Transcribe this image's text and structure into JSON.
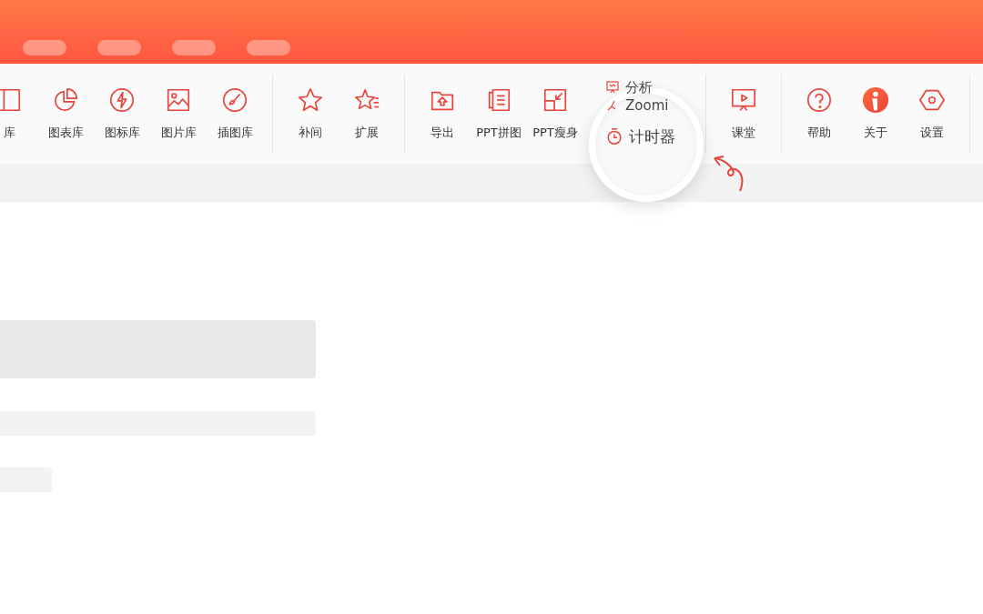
{
  "header": {
    "tabs": [
      {
        "kind": "placeholder"
      },
      {
        "kind": "placeholder"
      },
      {
        "kind": "placeholder"
      },
      {
        "kind": "placeholder"
      }
    ]
  },
  "toolbar": {
    "groups": [
      {
        "items": [
          {
            "label": "库"
          },
          {
            "label": "图表库"
          },
          {
            "label": "图标库"
          },
          {
            "label": "图片库"
          },
          {
            "label": "插图库"
          }
        ]
      },
      {
        "items": [
          {
            "label": "补间"
          },
          {
            "label": "扩展"
          }
        ]
      },
      {
        "items": [
          {
            "label": "导出"
          },
          {
            "label": "PPT拼图"
          },
          {
            "label": "PPT瘦身"
          }
        ],
        "menu": [
          {
            "label": "分析"
          },
          {
            "label": "Zoomi"
          },
          {
            "label": "计时器",
            "magnified": true
          }
        ]
      },
      {
        "items": [
          {
            "label": "课堂"
          }
        ]
      },
      {
        "items": [
          {
            "label": "帮助"
          },
          {
            "label": "关于"
          },
          {
            "label": "设置"
          }
        ]
      }
    ]
  }
}
